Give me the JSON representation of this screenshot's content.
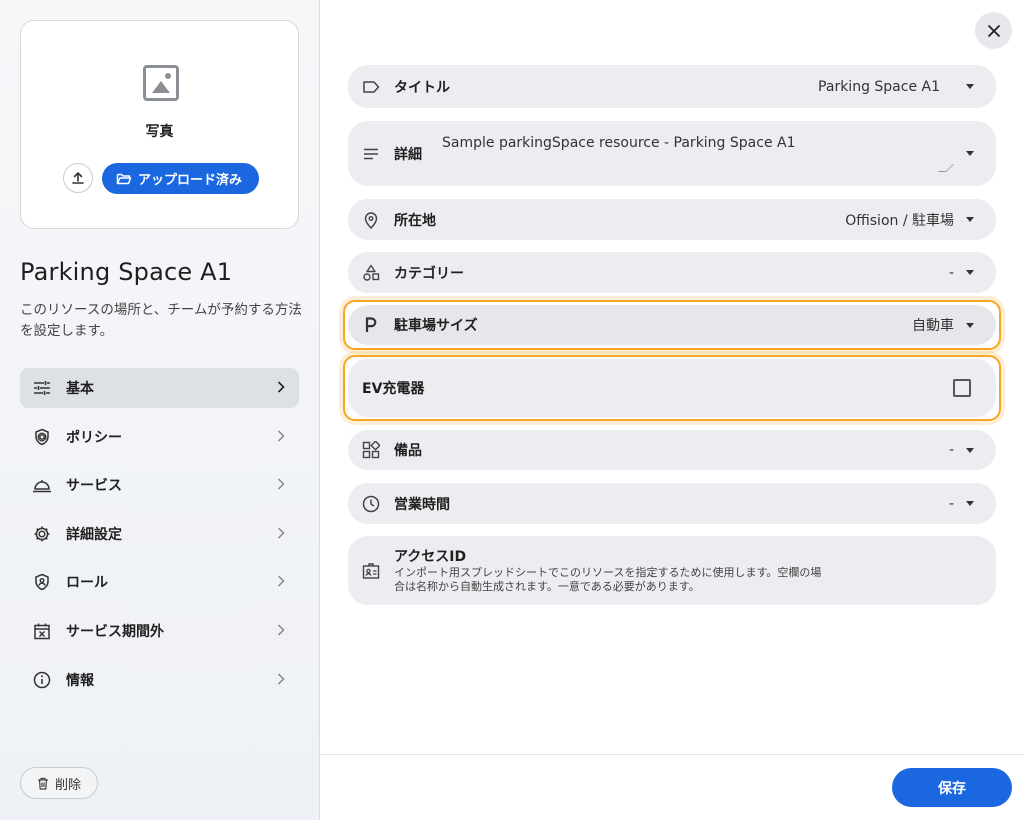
{
  "photo": {
    "label": "写真",
    "uploaded_label": "アップロード済み"
  },
  "page": {
    "title": "Parking Space A1",
    "description": "このリソースの場所と、チームが予約する方法を設定します。"
  },
  "nav": {
    "items": [
      {
        "label": "基本",
        "icon": "sliders-icon",
        "active": true
      },
      {
        "label": "ポリシー",
        "icon": "shield-at-icon"
      },
      {
        "label": "サービス",
        "icon": "service-bell-icon"
      },
      {
        "label": "詳細設定",
        "icon": "gear-icon"
      },
      {
        "label": "ロール",
        "icon": "shield-person-icon"
      },
      {
        "label": "サービス期間外",
        "icon": "calendar-x-icon"
      },
      {
        "label": "情報",
        "icon": "info-icon"
      }
    ]
  },
  "delete_label": "削除",
  "fields": {
    "title": {
      "label": "タイトル",
      "value": "Parking Space A1"
    },
    "details": {
      "label": "詳細",
      "value": "Sample parkingSpace resource - Parking Space A1"
    },
    "location": {
      "label": "所在地",
      "value": "Offision / 駐車場"
    },
    "category": {
      "label": "カテゴリー",
      "value": "-"
    },
    "parking_size": {
      "label": "駐車場サイズ",
      "value": "自動車"
    },
    "ev_charger": {
      "label": "EV充電器",
      "checked": false
    },
    "equipment": {
      "label": "備品",
      "value": "-"
    },
    "hours": {
      "label": "営業時間",
      "value": "-"
    },
    "access_id": {
      "label": "アクセスID",
      "desc_line1": "インポート用スプレッドシートでこのリソースを指定するために使用します。空欄の場",
      "desc_line2": "合は名称から自動生成されます。一意である必要があります。"
    }
  },
  "save_label": "保存",
  "colors": {
    "accent": "#1a67e0",
    "highlight": "#f5a623",
    "field_bg": "#ebedf0"
  }
}
